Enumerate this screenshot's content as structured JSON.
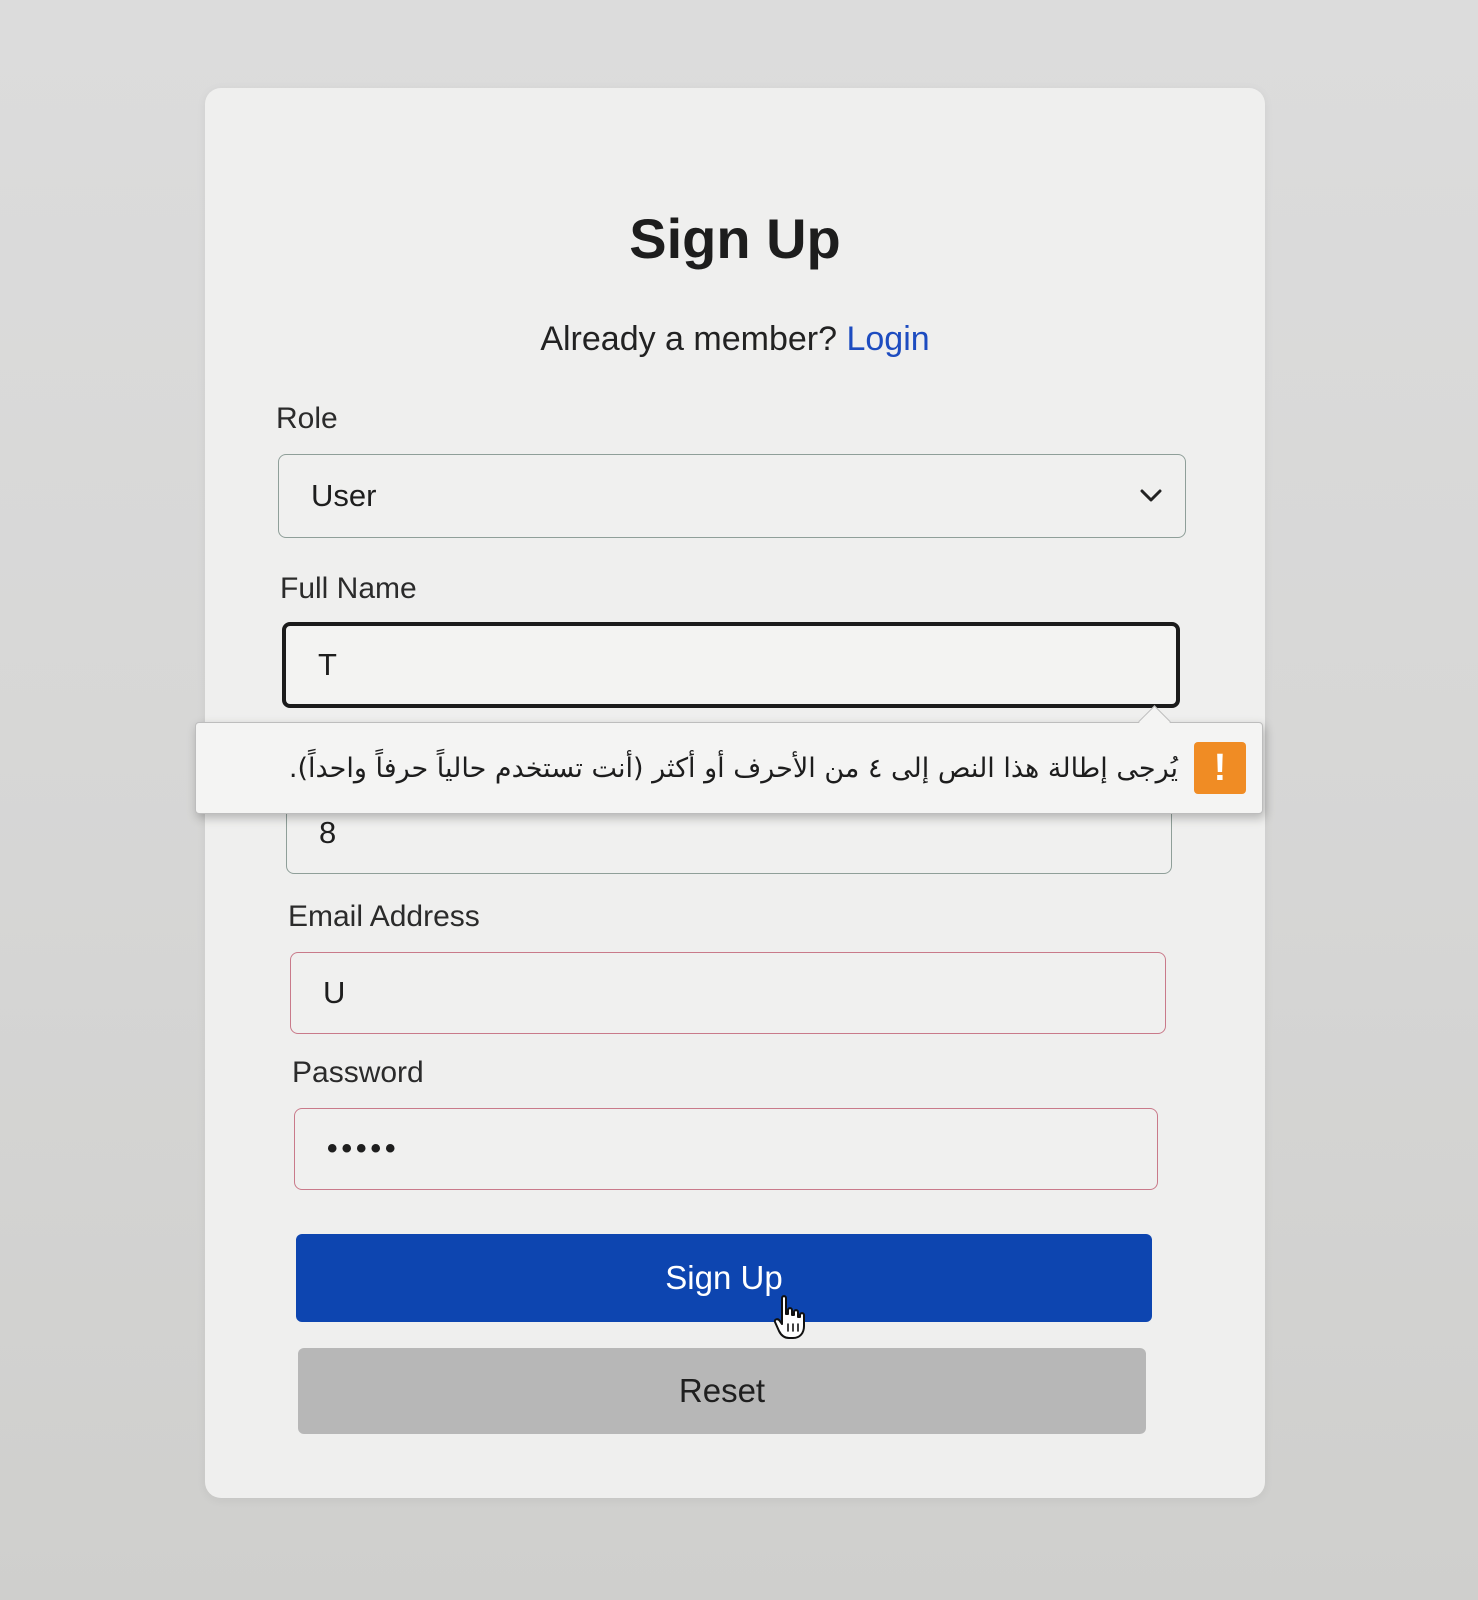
{
  "form": {
    "title": "Sign Up",
    "subtitle_prefix": "Already a member?",
    "login_link": "Login"
  },
  "fields": {
    "role": {
      "label": "Role",
      "value": "User"
    },
    "full_name": {
      "label": "Full Name",
      "value": "T"
    },
    "hidden_field": {
      "value": "8"
    },
    "email": {
      "label": "Email Address",
      "value": "U"
    },
    "password": {
      "label": "Password",
      "value": "•••••"
    }
  },
  "validation_tooltip": {
    "message": "يُرجى إطالة هذا النص إلى ٤ من الأحرف أو أكثر (أنت تستخدم حالياً حرفاً واحداً).",
    "icon": "warning-icon",
    "icon_glyph": "!",
    "icon_color": "#f08c24"
  },
  "buttons": {
    "submit": "Sign Up",
    "reset": "Reset"
  },
  "colors": {
    "primary": "#0d45b0",
    "link": "#1d4cc0",
    "secondary": "#b7b7b7"
  }
}
